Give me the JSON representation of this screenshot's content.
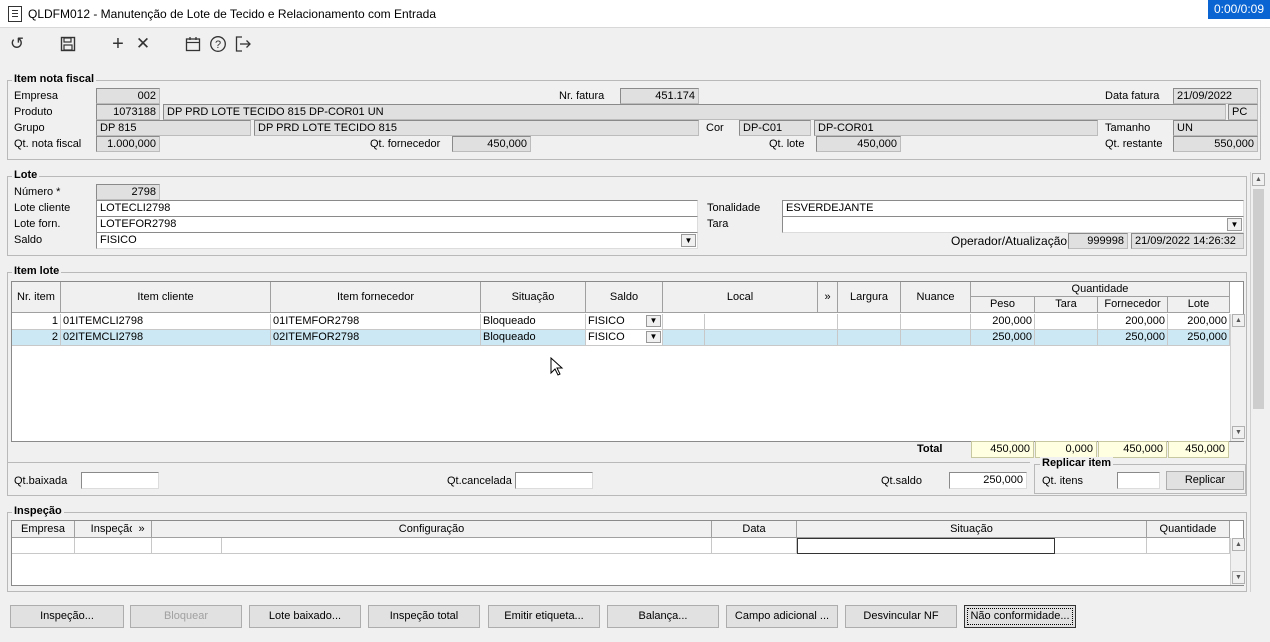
{
  "window": {
    "title": "QLDFM012 - Manutenção de Lote de Tecido e Relacionamento com Entrada",
    "timer": "0:00/0:09"
  },
  "toolbar": [
    "undo-icon",
    "save-icon",
    "add-icon",
    "close-icon",
    "calendar-icon",
    "help-icon",
    "exit-icon"
  ],
  "item_nf": {
    "title": "Item nota fiscal",
    "empresa_label": "Empresa",
    "empresa": "002",
    "nr_fatura_label": "Nr. fatura",
    "nr_fatura": "451.174",
    "data_fatura_label": "Data fatura",
    "data_fatura": "21/09/2022",
    "produto_label": "Produto",
    "produto_cod": "1073188",
    "produto_desc": "DP PRD LOTE TECIDO 815 DP-COR01 UN",
    "produto_un": "PC",
    "grupo_label": "Grupo",
    "grupo_cod": "DP 815",
    "grupo_desc": "DP PRD LOTE TECIDO 815",
    "cor_label": "Cor",
    "cor_cod": "DP-C01",
    "cor_desc": "DP-COR01",
    "tamanho_label": "Tamanho",
    "tamanho": "UN",
    "qt_nf_label": "Qt. nota fiscal",
    "qt_nf": "1.000,000",
    "qt_forn_label": "Qt. fornecedor",
    "qt_forn": "450,000",
    "qt_lote_label": "Qt. lote",
    "qt_lote": "450,000",
    "qt_rest_label": "Qt. restante",
    "qt_rest": "550,000"
  },
  "lote": {
    "title": "Lote",
    "numero_label": "Número *",
    "numero": "2798",
    "lote_cliente_label": "Lote cliente",
    "lote_cliente": "LOTECLI2798",
    "lote_forn_label": "Lote forn.",
    "lote_forn": "LOTEFOR2798",
    "saldo_label": "Saldo",
    "saldo": "FISICO",
    "tonalidade_label": "Tonalidade",
    "tonalidade": "ESVERDEJANTE",
    "tara_label": "Tara",
    "tara": "",
    "operador_label": "Operador/Atualização",
    "operador": "999998",
    "atualizacao": "21/09/2022 14:26:32"
  },
  "item_lote": {
    "title": "Item lote",
    "headers": {
      "nr_item": "Nr. item",
      "item_cliente": "Item cliente",
      "item_fornecedor": "Item fornecedor",
      "situacao": "Situação",
      "saldo": "Saldo",
      "local": "Local",
      "more": "»",
      "largura": "Largura",
      "nuance": "Nuance",
      "quantidade": "Quantidade",
      "peso": "Peso",
      "tara": "Tara",
      "fornecedor": "Fornecedor",
      "lote": "Lote"
    },
    "rows": [
      {
        "nr": "1",
        "item_cliente": "01ITEMCLI2798",
        "item_fornecedor": "01ITEMFOR2798",
        "situacao": "Bloqueado",
        "saldo": "FISICO",
        "local": "",
        "largura": "",
        "nuance": "",
        "peso": "200,000",
        "tara": "",
        "fornecedor": "200,000",
        "lote": "200,000"
      },
      {
        "nr": "2",
        "item_cliente": "02ITEMCLI2798",
        "item_fornecedor": "02ITEMFOR2798",
        "situacao": "Bloqueado",
        "saldo": "FISICO",
        "local": "",
        "largura": "",
        "nuance": "",
        "peso": "250,000",
        "tara": "",
        "fornecedor": "250,000",
        "lote": "250,000"
      }
    ],
    "total_label": "Total",
    "total_peso": "450,000",
    "total_tara": "0,000",
    "total_fornecedor": "450,000",
    "total_lote": "450,000",
    "qt_baixada_label": "Qt.baixada",
    "qt_baixada": "",
    "qt_cancelada_label": "Qt.cancelada",
    "qt_cancelada": "",
    "qt_saldo_label": "Qt.saldo",
    "qt_saldo": "250,000",
    "replicar_title": "Replicar item",
    "qt_itens_label": "Qt. itens",
    "qt_itens": "",
    "replicar_button": "Replicar"
  },
  "inspecao": {
    "title": "Inspeção",
    "headers": {
      "empresa": "Empresa",
      "inspecao": "Inspeção",
      "more": "»",
      "configuracao": "Configuração",
      "data": "Data",
      "situacao": "Situação",
      "quantidade": "Quantidade"
    }
  },
  "buttons": [
    "Inspeção...",
    "Bloquear",
    "Lote baixado...",
    "Inspeção total",
    "Emitir etiqueta...",
    "Balança...",
    "Campo adicional ...",
    "Desvincular NF",
    "Não conformidade..."
  ]
}
